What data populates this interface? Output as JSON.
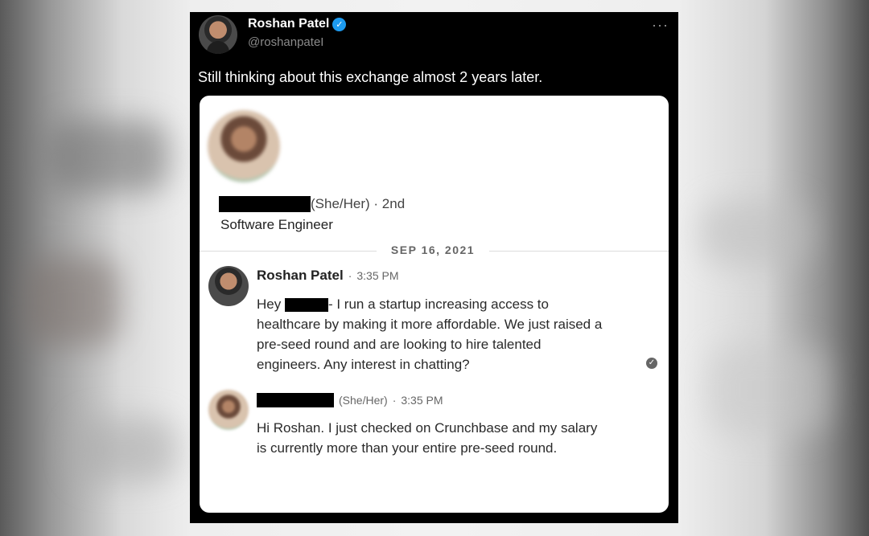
{
  "tweet": {
    "author_name": "Roshan Patel",
    "author_handle": "@roshanpateI",
    "text": "Still thinking about this exchange almost 2 years later.",
    "icons": {
      "verified": "verified-badge-icon",
      "more": "more-options-icon"
    },
    "colors": {
      "verified": "#1d9bf0",
      "background": "#000000"
    }
  },
  "card": {
    "profile": {
      "pronouns_degree": "(She/Her) · 2nd",
      "title": "Software Engineer"
    },
    "date_divider": "SEP 16, 2021",
    "messages": [
      {
        "sender": "Roshan Patel",
        "separator": "·",
        "time": "3:35 PM",
        "text_prefix": "Hey ",
        "text_suffix": "- I run a startup increasing access to healthcare by making it more affordable. We just raised a pre-seed round and are looking to hire talented engineers. Any interest in chatting?"
      },
      {
        "pronouns": "(She/Her)",
        "separator": "·",
        "time": "3:35 PM",
        "text": "Hi Roshan. I just checked on Crunchbase and my salary is currently more than your entire pre-seed round."
      }
    ],
    "read_receipt_glyph": "✓"
  }
}
